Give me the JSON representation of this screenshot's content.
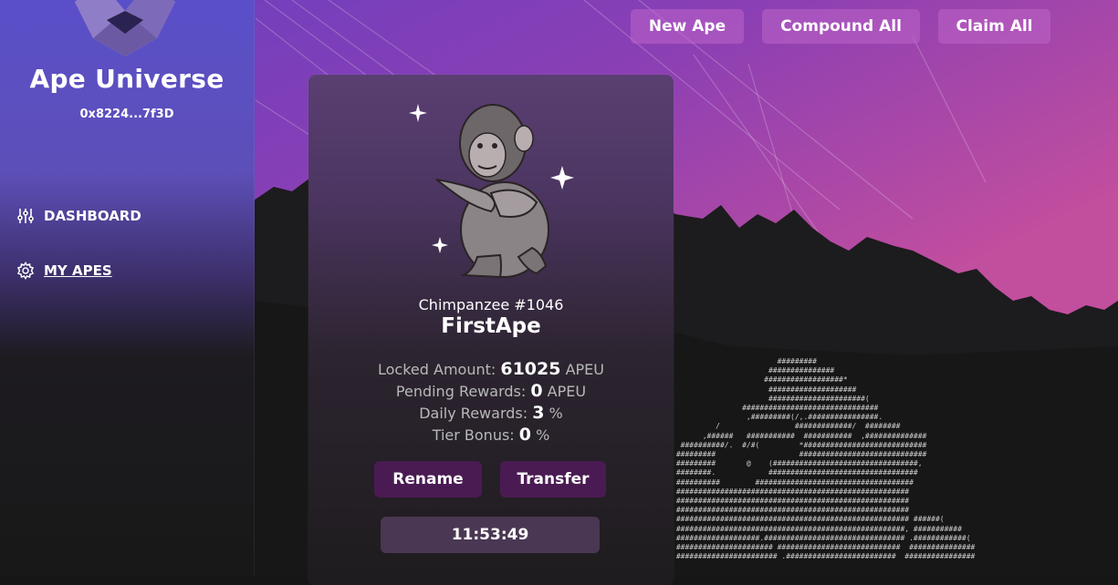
{
  "app": {
    "name": "Ape Universe",
    "wallet_address": "0x8224...7f3D"
  },
  "nav": [
    {
      "label": "DASHBOARD",
      "icon": "sliders-icon",
      "active": false
    },
    {
      "label": "MY APES",
      "icon": "gear-icon",
      "active": true
    }
  ],
  "top_buttons": {
    "new_ape": "New Ape",
    "compound_all": "Compound All",
    "claim_all": "Claim All"
  },
  "ape_card": {
    "species": "Chimpanzee #1046",
    "name": "FirstApe",
    "locked_label": "Locked Amount:",
    "locked_value": "61025",
    "locked_unit": "APEU",
    "pending_label": "Pending Rewards:",
    "pending_value": "0",
    "pending_unit": "APEU",
    "daily_label": "Daily Rewards:",
    "daily_value": "3",
    "daily_unit": "%",
    "tier_label": "Tier Bonus:",
    "tier_value": "0",
    "tier_unit": "%",
    "rename_label": "Rename",
    "transfer_label": "Transfer",
    "timer": "11:53:49"
  },
  "colors": {
    "sidebar_top": "#5a4fc9",
    "sky_purple": "#8a3fb0",
    "sky_pink": "#c84fa0",
    "button_purple": "#4a1b52",
    "top_button": "#b864c8"
  }
}
